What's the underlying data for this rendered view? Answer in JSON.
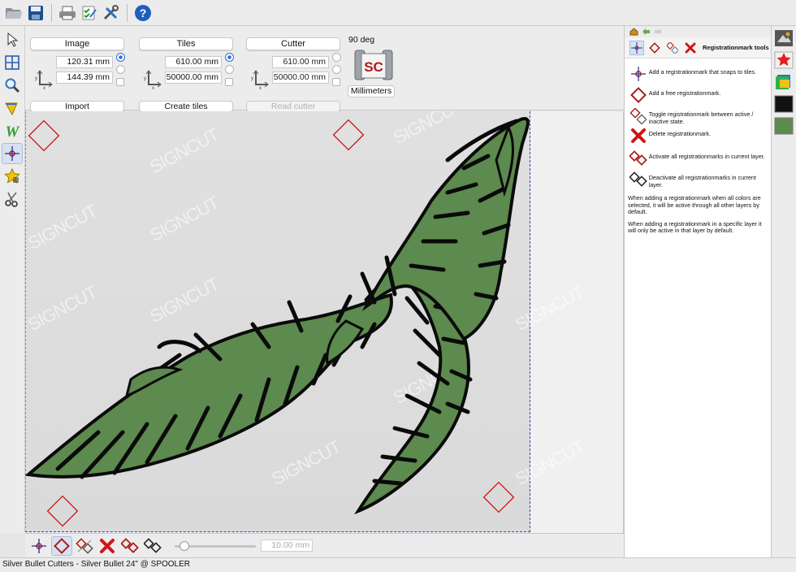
{
  "params": {
    "image": {
      "title": "Image",
      "x": "120.31 mm",
      "y": "144.39 mm",
      "action": "Import"
    },
    "tiles": {
      "title": "Tiles",
      "x": "610.00 mm",
      "y": "50000.00 mm",
      "action": "Create tiles"
    },
    "cutter": {
      "title": "Cutter",
      "x": "610.00 mm",
      "y": "50000.00 mm",
      "action": "Read cutter"
    },
    "rotation": "90 deg",
    "sc_logo": "SC",
    "unit": "Millimeters"
  },
  "watermark": {
    "sign": "SIGN",
    "cut": "CUT"
  },
  "bottom": {
    "size_value": "10.00 mm"
  },
  "status": "Silver Bullet Cutters - Silver Bullet 24\" @ SPOOLER",
  "panel": {
    "title": "Registrationmark tools",
    "items": [
      {
        "icon": "crosshair-mark-icon",
        "text": "Add a registrationmark that snaps to tiles."
      },
      {
        "icon": "diamond-mark-icon",
        "text": "Add a free registrationmark."
      },
      {
        "icon": "toggle-mark-icon",
        "text": "Toggle registrationmark between active / inactive state."
      },
      {
        "icon": "delete-x-icon",
        "text": "Delete registrationmark."
      },
      {
        "icon": "activate-marks-icon",
        "text": "Activate all registrationmarks in current layer."
      },
      {
        "icon": "deactivate-marks-icon",
        "text": "Deactivate all registrationmarks in current layer."
      }
    ],
    "note1": "When adding a registrationmark when all colors are selected, it will be active through all other layers by default.",
    "note2": "When adding a registrationmark in a specific layer it will only be active in that layer by default."
  },
  "colors": {
    "accent": "#2a6fd6",
    "mark_red": "#cc1111",
    "leaf_green": "#5d8a4e",
    "outline": "#0a0a0a"
  }
}
